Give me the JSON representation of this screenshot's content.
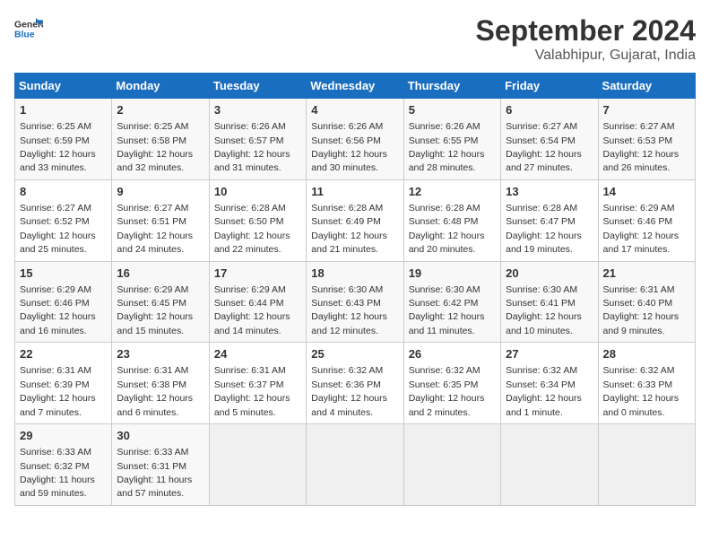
{
  "logo": {
    "line1": "General",
    "line2": "Blue"
  },
  "title": "September 2024",
  "subtitle": "Valabhipur, Gujarat, India",
  "weekdays": [
    "Sunday",
    "Monday",
    "Tuesday",
    "Wednesday",
    "Thursday",
    "Friday",
    "Saturday"
  ],
  "weeks": [
    [
      {
        "num": "1",
        "sunrise": "6:25 AM",
        "sunset": "6:59 PM",
        "daylight": "12 hours and 33 minutes."
      },
      {
        "num": "2",
        "sunrise": "6:25 AM",
        "sunset": "6:58 PM",
        "daylight": "12 hours and 32 minutes."
      },
      {
        "num": "3",
        "sunrise": "6:26 AM",
        "sunset": "6:57 PM",
        "daylight": "12 hours and 31 minutes."
      },
      {
        "num": "4",
        "sunrise": "6:26 AM",
        "sunset": "6:56 PM",
        "daylight": "12 hours and 30 minutes."
      },
      {
        "num": "5",
        "sunrise": "6:26 AM",
        "sunset": "6:55 PM",
        "daylight": "12 hours and 28 minutes."
      },
      {
        "num": "6",
        "sunrise": "6:27 AM",
        "sunset": "6:54 PM",
        "daylight": "12 hours and 27 minutes."
      },
      {
        "num": "7",
        "sunrise": "6:27 AM",
        "sunset": "6:53 PM",
        "daylight": "12 hours and 26 minutes."
      }
    ],
    [
      {
        "num": "8",
        "sunrise": "6:27 AM",
        "sunset": "6:52 PM",
        "daylight": "12 hours and 25 minutes."
      },
      {
        "num": "9",
        "sunrise": "6:27 AM",
        "sunset": "6:51 PM",
        "daylight": "12 hours and 24 minutes."
      },
      {
        "num": "10",
        "sunrise": "6:28 AM",
        "sunset": "6:50 PM",
        "daylight": "12 hours and 22 minutes."
      },
      {
        "num": "11",
        "sunrise": "6:28 AM",
        "sunset": "6:49 PM",
        "daylight": "12 hours and 21 minutes."
      },
      {
        "num": "12",
        "sunrise": "6:28 AM",
        "sunset": "6:48 PM",
        "daylight": "12 hours and 20 minutes."
      },
      {
        "num": "13",
        "sunrise": "6:28 AM",
        "sunset": "6:47 PM",
        "daylight": "12 hours and 19 minutes."
      },
      {
        "num": "14",
        "sunrise": "6:29 AM",
        "sunset": "6:46 PM",
        "daylight": "12 hours and 17 minutes."
      }
    ],
    [
      {
        "num": "15",
        "sunrise": "6:29 AM",
        "sunset": "6:46 PM",
        "daylight": "12 hours and 16 minutes."
      },
      {
        "num": "16",
        "sunrise": "6:29 AM",
        "sunset": "6:45 PM",
        "daylight": "12 hours and 15 minutes."
      },
      {
        "num": "17",
        "sunrise": "6:29 AM",
        "sunset": "6:44 PM",
        "daylight": "12 hours and 14 minutes."
      },
      {
        "num": "18",
        "sunrise": "6:30 AM",
        "sunset": "6:43 PM",
        "daylight": "12 hours and 12 minutes."
      },
      {
        "num": "19",
        "sunrise": "6:30 AM",
        "sunset": "6:42 PM",
        "daylight": "12 hours and 11 minutes."
      },
      {
        "num": "20",
        "sunrise": "6:30 AM",
        "sunset": "6:41 PM",
        "daylight": "12 hours and 10 minutes."
      },
      {
        "num": "21",
        "sunrise": "6:31 AM",
        "sunset": "6:40 PM",
        "daylight": "12 hours and 9 minutes."
      }
    ],
    [
      {
        "num": "22",
        "sunrise": "6:31 AM",
        "sunset": "6:39 PM",
        "daylight": "12 hours and 7 minutes."
      },
      {
        "num": "23",
        "sunrise": "6:31 AM",
        "sunset": "6:38 PM",
        "daylight": "12 hours and 6 minutes."
      },
      {
        "num": "24",
        "sunrise": "6:31 AM",
        "sunset": "6:37 PM",
        "daylight": "12 hours and 5 minutes."
      },
      {
        "num": "25",
        "sunrise": "6:32 AM",
        "sunset": "6:36 PM",
        "daylight": "12 hours and 4 minutes."
      },
      {
        "num": "26",
        "sunrise": "6:32 AM",
        "sunset": "6:35 PM",
        "daylight": "12 hours and 2 minutes."
      },
      {
        "num": "27",
        "sunrise": "6:32 AM",
        "sunset": "6:34 PM",
        "daylight": "12 hours and 1 minute."
      },
      {
        "num": "28",
        "sunrise": "6:32 AM",
        "sunset": "6:33 PM",
        "daylight": "12 hours and 0 minutes."
      }
    ],
    [
      {
        "num": "29",
        "sunrise": "6:33 AM",
        "sunset": "6:32 PM",
        "daylight": "11 hours and 59 minutes."
      },
      {
        "num": "30",
        "sunrise": "6:33 AM",
        "sunset": "6:31 PM",
        "daylight": "11 hours and 57 minutes."
      },
      null,
      null,
      null,
      null,
      null
    ]
  ],
  "labels": {
    "sunrise": "Sunrise:",
    "sunset": "Sunset:",
    "daylight": "Daylight:"
  }
}
